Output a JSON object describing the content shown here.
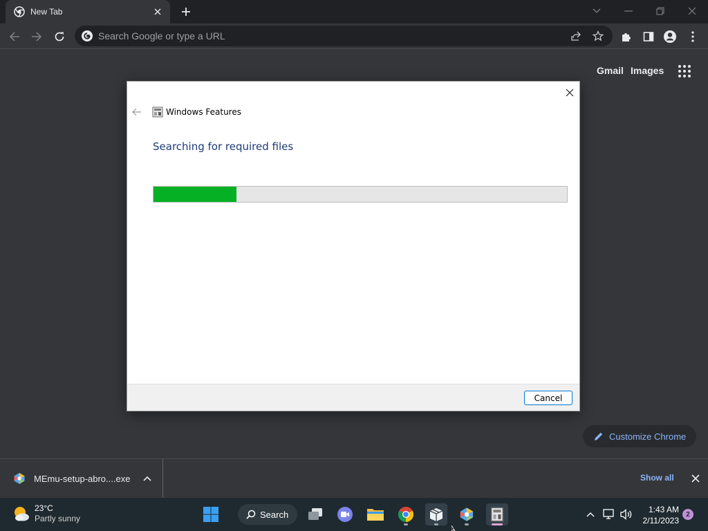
{
  "browser": {
    "tab": {
      "title": "New Tab"
    },
    "omnibox": {
      "placeholder": "Search Google or type a URL"
    }
  },
  "ntp": {
    "gmail_label": "Gmail",
    "images_label": "Images",
    "customize_label": "Customize Chrome"
  },
  "dialog": {
    "title": "Windows Features",
    "heading": "Searching for required files",
    "progress_percent": 20,
    "cancel_label": "Cancel"
  },
  "downloads": {
    "item_name": "MEmu-setup-abro....exe",
    "show_all_label": "Show all"
  },
  "taskbar": {
    "weather_temp": "23°C",
    "weather_desc": "Partly sunny",
    "search_label": "Search",
    "time": "1:43 AM",
    "date": "2/11/2023",
    "notification_count": "2"
  },
  "colors": {
    "progress_fill": "#06b025",
    "accent_link": "#8ab4f8",
    "dialog_heading": "#1e3a78"
  }
}
